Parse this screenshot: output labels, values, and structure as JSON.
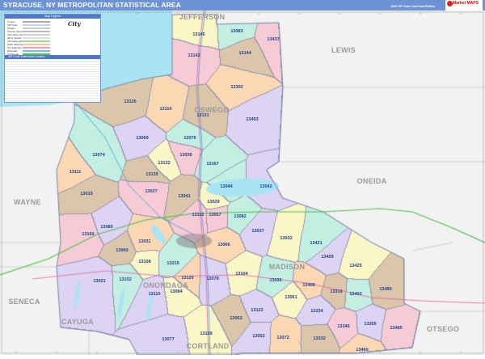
{
  "header": {
    "title": "SYRACUSE, NY METROPOLITAN STATISTICAL AREA",
    "edition": "2020 ZIP Code ColorCast Edition",
    "logo_text": "Market MAPS"
  },
  "legend": {
    "title": "Map Legend",
    "items": [
      "County",
      "ZIP Code",
      "Streets",
      "Primary Streets",
      "Secondary Streets",
      "Minor Streets",
      "Interstate Highways",
      "State Highways",
      "US Highways",
      "Railroads",
      "Toll Roads"
    ],
    "index_title": "ZIP Code Index/Area Locator",
    "compass_label": "City"
  },
  "counties": [
    "JEFFERSON",
    "LEWIS",
    "OSWEGO",
    "ONEIDA",
    "WAYNE",
    "MADISON",
    "ONONDAGA",
    "SENECA",
    "CAYUGA",
    "CORTLAND",
    "OTSEGO"
  ],
  "zips": [
    "13145",
    "13083",
    "13437",
    "13142",
    "13144",
    "13302",
    "13126",
    "13114",
    "13131",
    "13493",
    "13069",
    "13076",
    "13036",
    "13132",
    "13167",
    "13074",
    "13111",
    "13135",
    "13042",
    "13044",
    "13033",
    "13027",
    "13041",
    "13029",
    "13112",
    "13057",
    "13082",
    "13080",
    "13166",
    "13037",
    "13031",
    "13060",
    "13066",
    "13108",
    "13215",
    "13104",
    "13021",
    "13152",
    "13078",
    "13120",
    "13110",
    "13084",
    "13063",
    "13122",
    "13077",
    "13159",
    "13052",
    "13032",
    "13421",
    "13409",
    "13425",
    "13035",
    "13408",
    "13310",
    "13402",
    "13480",
    "13061",
    "13334",
    "13346",
    "13355",
    "13485",
    "13072",
    "13332",
    "13460"
  ],
  "colors": {
    "header": "#6d93d6",
    "lake": "#a8e4f4",
    "outside": "#f2f2f2",
    "zip_palette": [
      "#f7cbd6",
      "#fbd8b3",
      "#dcc6aa",
      "#ddd3f3",
      "#c2efe2",
      "#fbf6c6"
    ],
    "interstate_90": "#4cbf4c",
    "interstate_81": "#3aa0d8",
    "us_route": "#e86aa8"
  }
}
